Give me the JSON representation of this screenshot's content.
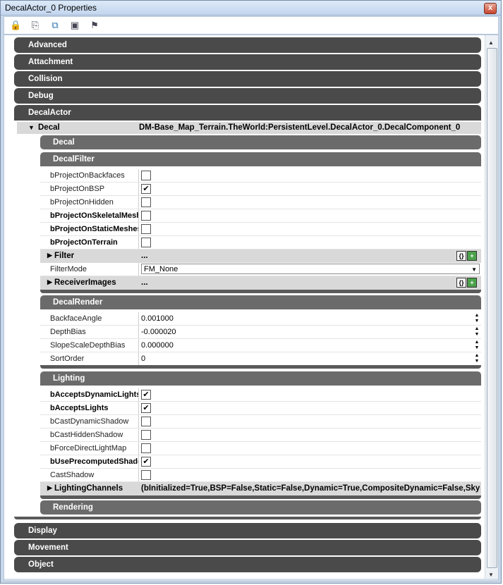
{
  "window": {
    "title": "DecalActor_0 Properties",
    "close": "x"
  },
  "toolbar": {
    "icons": [
      "lock-icon",
      "copy-icon",
      "view-icon",
      "export-icon",
      "find-icon"
    ],
    "glyphs": [
      "🔒",
      "⎘",
      "⧉",
      "▣",
      "⚑"
    ]
  },
  "categories": {
    "advanced": "Advanced",
    "attachment": "Attachment",
    "collision": "Collision",
    "debug": "Debug",
    "decalactor": "DecalActor",
    "display": "Display",
    "movement": "Movement",
    "object": "Object"
  },
  "decal": {
    "label": "Decal",
    "value": "DM-Base_Map_Terrain.TheWorld:PersistentLevel.DecalActor_0.DecalComponent_0"
  },
  "subcats": {
    "decal": "Decal",
    "decalfilter": "DecalFilter",
    "decalrender": "DecalRender",
    "lighting": "Lighting",
    "rendering": "Rendering"
  },
  "filter_props": [
    {
      "name": "bProjectOnBackfaces",
      "checked": false,
      "bold": false
    },
    {
      "name": "bProjectOnBSP",
      "checked": true,
      "bold": false
    },
    {
      "name": "bProjectOnHidden",
      "checked": false,
      "bold": false
    },
    {
      "name": "bProjectOnSkeletalMeshes",
      "checked": false,
      "bold": true
    },
    {
      "name": "bProjectOnStaticMeshes",
      "checked": false,
      "bold": true
    },
    {
      "name": "bProjectOnTerrain",
      "checked": false,
      "bold": true
    }
  ],
  "filter": {
    "label": "Filter",
    "value": "..."
  },
  "filtermode": {
    "label": "FilterMode",
    "value": "FM_None"
  },
  "receiverimages": {
    "label": "ReceiverImages",
    "value": "..."
  },
  "render_props": [
    {
      "name": "BackfaceAngle",
      "value": "0.001000"
    },
    {
      "name": "DepthBias",
      "value": "-0.000020"
    },
    {
      "name": "SlopeScaleDepthBias",
      "value": "0.000000"
    },
    {
      "name": "SortOrder",
      "value": "0"
    }
  ],
  "lighting_props": [
    {
      "name": "bAcceptsDynamicLights",
      "checked": true,
      "bold": true
    },
    {
      "name": "bAcceptsLights",
      "checked": true,
      "bold": true
    },
    {
      "name": "bCastDynamicShadow",
      "checked": false,
      "bold": false
    },
    {
      "name": "bCastHiddenShadow",
      "checked": false,
      "bold": false
    },
    {
      "name": "bForceDirectLightMap",
      "checked": false,
      "bold": false
    },
    {
      "name": "bUsePrecomputedShadows",
      "checked": true,
      "bold": true
    },
    {
      "name": "CastShadow",
      "checked": false,
      "bold": false
    }
  ],
  "lightingchannels": {
    "label": "LightingChannels",
    "value": "(bInitialized=True,BSP=False,Static=False,Dynamic=True,CompositeDynamic=False,Skybox=False)"
  },
  "check_glyph": "✔",
  "array_buttons": {
    "empty": "{}",
    "add": "+"
  }
}
